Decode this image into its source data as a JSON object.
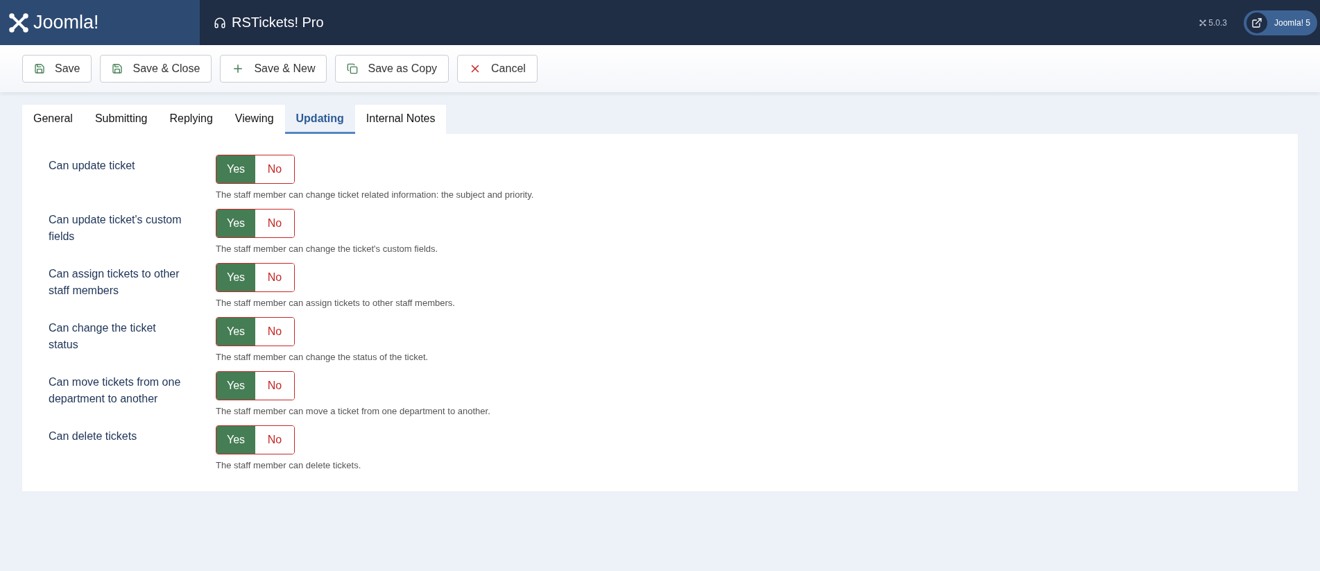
{
  "header": {
    "logo": "Joomla!",
    "title": "RSTickets! Pro",
    "version": "5.0.3",
    "site_button": "Joomla! 5"
  },
  "toolbar": [
    {
      "kind": "save",
      "label": "Save"
    },
    {
      "kind": "save",
      "label": "Save & Close"
    },
    {
      "kind": "new",
      "label": "Save & New"
    },
    {
      "kind": "copy",
      "label": "Save as Copy"
    },
    {
      "kind": "cancel",
      "label": "Cancel"
    }
  ],
  "tabs": [
    {
      "label": "General",
      "selected": false
    },
    {
      "label": "Submitting",
      "selected": false
    },
    {
      "label": "Replying",
      "selected": false
    },
    {
      "label": "Viewing",
      "selected": false
    },
    {
      "label": "Updating",
      "selected": true
    },
    {
      "label": "Internal Notes",
      "selected": false
    }
  ],
  "fields": [
    {
      "label": "Can update ticket",
      "options": [
        {
          "label": "Yes",
          "selected": true
        },
        {
          "label": "No",
          "selected": false
        }
      ],
      "description": "The staff member can change ticket related information: the subject and priority."
    },
    {
      "label": "Can update ticket's custom fields",
      "options": [
        {
          "label": "Yes",
          "selected": true
        },
        {
          "label": "No",
          "selected": false
        }
      ],
      "description": "The staff member can change the ticket's custom fields."
    },
    {
      "label": "Can assign tickets to other staff members",
      "options": [
        {
          "label": "Yes",
          "selected": true
        },
        {
          "label": "No",
          "selected": false
        }
      ],
      "description": "The staff member can assign tickets to other staff members."
    },
    {
      "label": "Can change the ticket status",
      "options": [
        {
          "label": "Yes",
          "selected": true
        },
        {
          "label": "No",
          "selected": false
        }
      ],
      "description": "The staff member can change the status of the ticket."
    },
    {
      "label": "Can move tickets from one department to another",
      "options": [
        {
          "label": "Yes",
          "selected": true
        },
        {
          "label": "No",
          "selected": false
        }
      ],
      "description": "The staff member can move a ticket from one department to another."
    },
    {
      "label": "Can delete tickets",
      "options": [
        {
          "label": "Yes",
          "selected": true
        },
        {
          "label": "No",
          "selected": false
        }
      ],
      "description": "The staff member can delete tickets."
    }
  ]
}
